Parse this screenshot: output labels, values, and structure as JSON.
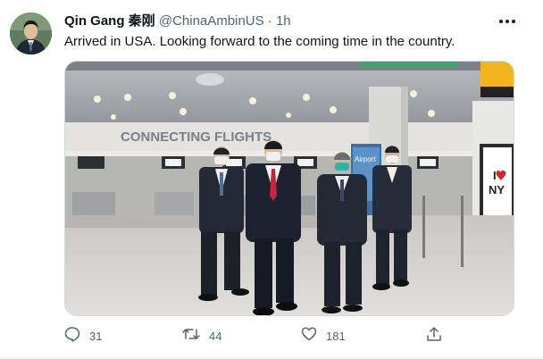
{
  "author": {
    "name": "Qin Gang 秦刚",
    "handle": "@ChinaAmbinUS",
    "separator": "·",
    "time": "1h"
  },
  "tweet": {
    "text": "Arrived in USA. Looking forward to the coming time in the country."
  },
  "photo": {
    "sign_text": "CONNECTING FLIGHTS",
    "ad_text_line1": "I",
    "ad_text_line2": "NY",
    "kiosk_text": "Airport"
  },
  "actions": {
    "reply_count": "31",
    "retweet_count": "44",
    "like_count": "181"
  },
  "icons": {
    "reply": "reply-icon",
    "retweet": "retweet-icon",
    "like": "heart-icon",
    "share": "share-icon",
    "more": "more-dots-icon"
  },
  "colors": {
    "text": "#0f1419",
    "secondary": "#536471",
    "border": "#cfd9de"
  }
}
